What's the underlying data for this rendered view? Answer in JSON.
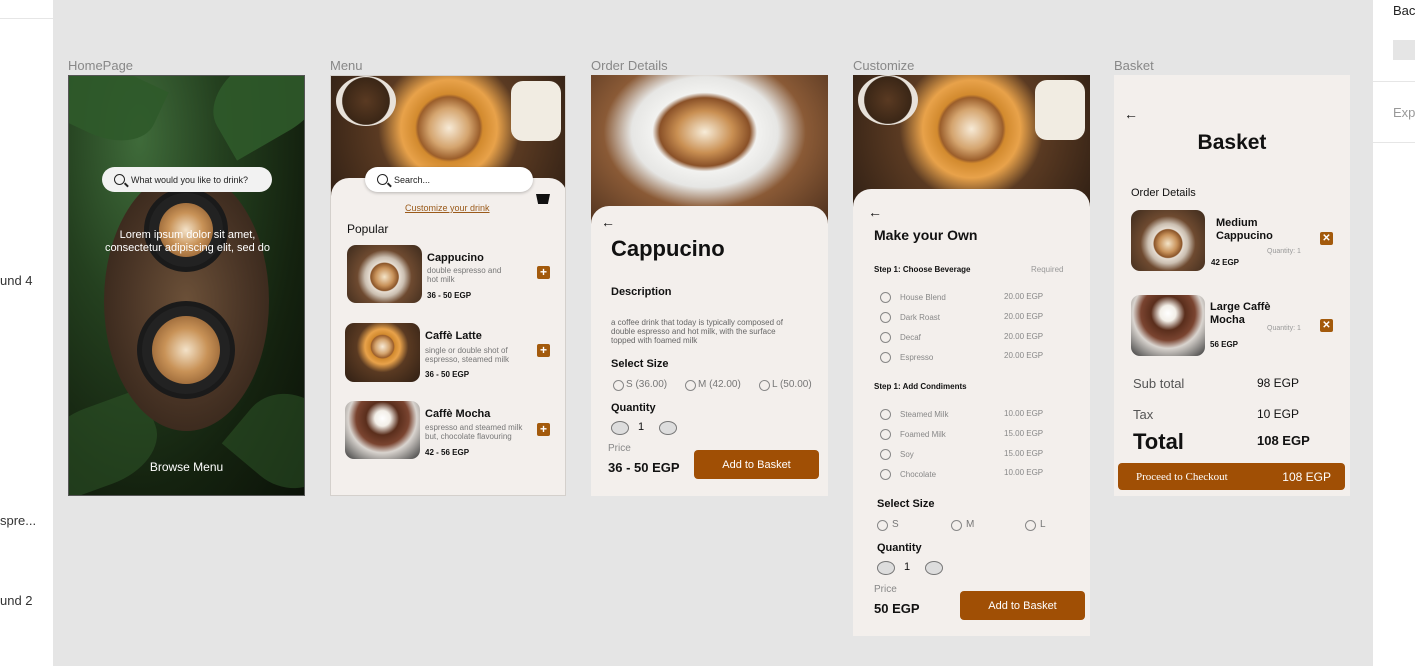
{
  "left_panel": {
    "layers": [
      "und 4",
      "spre...",
      "und 2"
    ]
  },
  "right_panel": {
    "background_label": "Bac",
    "export_label": "Exp",
    "swatch_color": "#e5e5e5"
  },
  "frames": {
    "homepage": {
      "label": "HomePage",
      "search_placeholder": "What would you like to drink?",
      "body_text": "Lorem ipsum dolor sit amet, consectetur adipiscing elit, sed do",
      "browse_label": "Browse Menu"
    },
    "menu": {
      "label": "Menu",
      "search_placeholder": "Search...",
      "customize_link": "Customize your drink",
      "section_title": "Popular",
      "items": [
        {
          "name": "Cappucino",
          "desc": "double espresso and hot milk",
          "price": "36 - 50  EGP"
        },
        {
          "name": "Caffè Latte",
          "desc": "single or double shot of espresso, steamed milk",
          "price": "36 - 50 EGP"
        },
        {
          "name": "Caffè Mocha",
          "desc": "espresso and steamed milk but, chocolate flavouring",
          "price": "42 - 56  EGP"
        }
      ]
    },
    "order_details": {
      "label": "Order Details",
      "back": "←",
      "title": "Cappucino",
      "description_heading": "Description",
      "description": "a coffee drink that today is typically composed of double espresso and hot milk, with the surface topped with foamed milk",
      "size_heading": "Select Size",
      "sizes": [
        "S (36.00)",
        "M (42.00)",
        "L (50.00)"
      ],
      "quantity_heading": "Quantity",
      "quantity": "1",
      "price_label": "Price",
      "price": "36 - 50  EGP",
      "add_button": "Add to Basket"
    },
    "customize": {
      "label": "Customize",
      "back": "←",
      "title": "Make your Own",
      "step1": "Step 1:  Choose Beverage",
      "required": "Required",
      "beverages": [
        {
          "name": "House Blend",
          "price": "20.00 EGP"
        },
        {
          "name": "Dark Roast",
          "price": "20.00 EGP"
        },
        {
          "name": "Decaf",
          "price": "20.00 EGP"
        },
        {
          "name": "Espresso",
          "price": "20.00 EGP"
        }
      ],
      "step2": "Step 1:  Add Condiments",
      "condiments": [
        {
          "name": "Steamed Milk",
          "price": "10.00 EGP"
        },
        {
          "name": "Foamed Milk",
          "price": "15.00 EGP"
        },
        {
          "name": "Soy",
          "price": "15.00 EGP"
        },
        {
          "name": "Chocolate",
          "price": "10.00 EGP"
        }
      ],
      "size_heading": "Select Size",
      "sizes": [
        "S",
        "M",
        "L"
      ],
      "quantity_heading": "Quantity",
      "quantity": "1",
      "price_label": "Price",
      "price": "50  EGP",
      "add_button": "Add to Basket"
    },
    "basket": {
      "label": "Basket",
      "back": "←",
      "title": "Basket",
      "order_heading": "Order Details",
      "items": [
        {
          "name": "Medium Cappucino",
          "price": "42 EGP",
          "quantity": "Quantity: 1"
        },
        {
          "name": "Large Caffè Mocha",
          "price": "56 EGP",
          "quantity": "Quantity: 1"
        }
      ],
      "subtotal_label": "Sub total",
      "subtotal": "98  EGP",
      "tax_label": "Tax",
      "tax": "10 EGP",
      "total_label": "Total",
      "total": "108  EGP",
      "checkout_label": "Proceed to Checkout",
      "checkout_amount": "108  EGP"
    }
  },
  "colors": {
    "accent": "#a04f05",
    "sheet": "#f3efec",
    "canvas": "#e5e5e5"
  }
}
